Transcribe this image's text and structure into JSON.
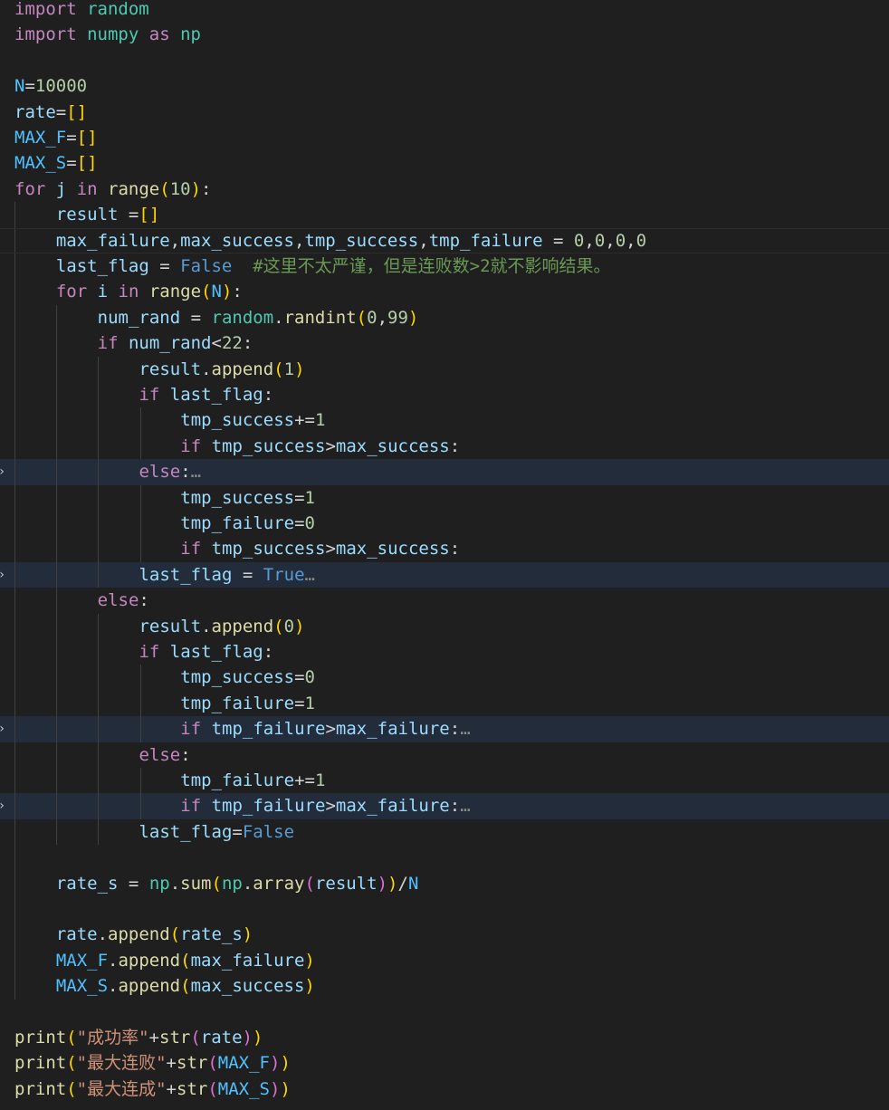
{
  "editor": {
    "language": "python",
    "folded_lines": [
      18,
      22,
      28,
      31
    ],
    "lines": [
      "import random",
      "import numpy as np",
      "",
      "N=10000",
      "rate=[]",
      "MAX_F=[]",
      "MAX_S=[]",
      "for j in range(10):",
      "    result =[]",
      "    max_failure,max_success,tmp_success,tmp_failure = 0,0,0,0",
      "    last_flag = False  #这里不太严谨，但是连败数>2就不影响结果。",
      "    for i in range(N):",
      "        num_rand = random.randint(0,99)",
      "        if num_rand<22:",
      "            result.append(1)",
      "            if last_flag:",
      "                tmp_success+=1",
      "                if tmp_success>max_success:",
      "            else:",
      "                tmp_success=1",
      "                tmp_failure=0",
      "                if tmp_success>max_success:",
      "            last_flag = True",
      "        else:",
      "            result.append(0)",
      "            if last_flag:",
      "                tmp_success=0",
      "                tmp_failure=1",
      "                if tmp_failure>max_failure:",
      "            else:",
      "                tmp_failure+=1",
      "                if tmp_failure>max_failure:",
      "            last_flag=False",
      "",
      "    rate_s = np.sum(np.array(result))/N",
      "",
      "    rate.append(rate_s)",
      "    MAX_F.append(max_failure)",
      "    MAX_S.append(max_success)",
      "",
      "print(\"成功率\"+str(rate))",
      "print(\"最大连败\"+str(MAX_F))",
      "print(\"最大连成\"+str(MAX_S))"
    ]
  },
  "colors": {
    "background": "#1f1f1f",
    "folded_line_highlight": "#222c3a",
    "indent_guide": "#404040",
    "keyword": "#c586c0",
    "variable": "#9cdcfe",
    "constant": "#4fc1ff",
    "function": "#dcdcaa",
    "module": "#4ec9b0",
    "number": "#b5cea8",
    "string": "#ce9178",
    "comment": "#6a9955",
    "boolean": "#569cd6"
  },
  "icons": {
    "fold": "chevron-right-icon",
    "folded_ellipsis": "…"
  }
}
